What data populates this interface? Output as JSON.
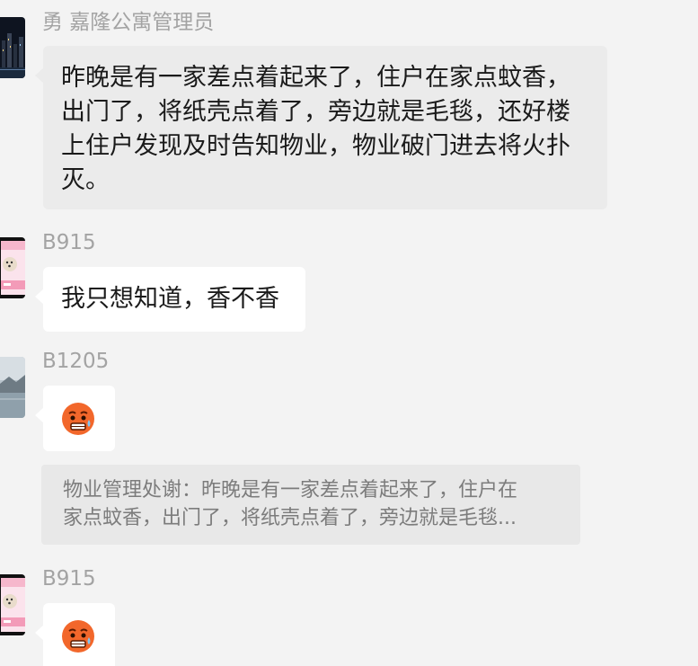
{
  "messages": [
    {
      "sender": "勇 嘉隆公寓管理员",
      "avatar": "city-night-avatar",
      "lines": [
        "昨晚是有一家差点着起来了，住户在家点蚊香，",
        "出门了，将纸壳点着了，旁边就是毛毯，还好楼",
        "上住户发现及时告知物业，物业破门进去将火扑",
        "灭。"
      ]
    },
    {
      "sender": "B915",
      "avatar": "puppy-avatar",
      "text": "我只想知道，香不香"
    },
    {
      "sender": "B1205",
      "avatar": "lake-avatar",
      "emoji": "sad-sweat-emoji-icon"
    },
    {
      "quote_lines": [
        "物业管理处谢：昨晚是有一家差点着起来了，住户在",
        "家点蚊香，出门了，将纸壳点着了，旁边就是毛毯..."
      ]
    },
    {
      "sender": "B915",
      "avatar": "puppy-avatar",
      "emoji": "sad-sweat-emoji-icon"
    }
  ],
  "colors": {
    "background": "#f3f3f3",
    "bubble_gray": "#ebebeb",
    "bubble_white": "#ffffff",
    "sender_text": "#a3a3a3",
    "quote_text": "#7c7c7c",
    "emoji_face": "#f2672b"
  }
}
